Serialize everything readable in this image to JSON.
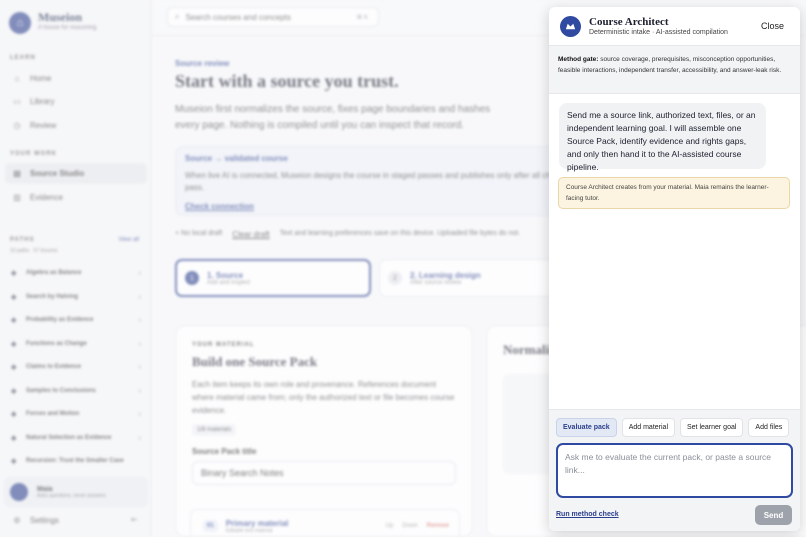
{
  "sidebar": {
    "brand_name": "Museion",
    "brand_tag": "A house for reasoning",
    "learn_header": "LEARN",
    "learn_items": [
      {
        "label": "Home",
        "icon": "home-icon"
      },
      {
        "label": "Library",
        "icon": "library-icon"
      },
      {
        "label": "Review",
        "icon": "review-icon"
      }
    ],
    "work_header": "YOUR WORK",
    "work_items": [
      {
        "label": "Source Studio",
        "icon": "source-icon",
        "active": true
      },
      {
        "label": "Evidence",
        "icon": "chart-icon"
      }
    ],
    "paths_header": "PATHS",
    "paths_view_all": "View all",
    "paths_count": "10 paths · 57 lessons",
    "paths": [
      "Algebra as Balance",
      "Search by Halving",
      "Probability as Evidence",
      "Functions as Change",
      "Claims to Evidence",
      "Samples to Conclusions",
      "Forces and Motion",
      "Natural Selection as Evidence",
      "Recursion: Trust the Smaller Case"
    ],
    "maia_name": "Maia",
    "maia_desc": "Asks questions, never answers",
    "settings": "Settings"
  },
  "main": {
    "search_placeholder": "Search courses and concepts",
    "search_kbd": "⌘ K",
    "eyebrow": "Source review",
    "title": "Start with a source you trust.",
    "lead": "Museion first normalizes the source, fixes page boundaries and hashes every page. Nothing is compiled until you can inspect that record.",
    "callout_title": "Source → validated course",
    "callout_body": "When live AI is connected, Museion designs the course in staged passes and publishes only after all checks pass.",
    "callout_link": "Check connection",
    "no_draft": "No local draft",
    "clear_draft": "Clear draft",
    "device_note": "Text and learning preferences save on this device. Uploaded file bytes do not.",
    "steps": [
      {
        "num": "1",
        "title": "1. Source",
        "sub": "Add and inspect"
      },
      {
        "num": "2",
        "title": "2. Learning design",
        "sub": "After source review"
      }
    ],
    "card_eyebrow": "YOUR MATERIAL",
    "card_title": "Build one Source Pack",
    "card_body": "Each item keeps its own role and provenance. References document where material came from; only the authorized text or file becomes course evidence.",
    "card_chip": "1/8 materials",
    "card_label": "Source Pack title",
    "card_input": "Binary Search Notes",
    "primary_badge": "01",
    "primary_title": "Primary material",
    "primary_sub": "Editable text material",
    "primary_up": "Up",
    "primary_down": "Down",
    "primary_remove": "Remove",
    "card2_title": "Normaliz"
  },
  "panel": {
    "title": "Course Architect",
    "subtitle": "Deterministic intake · AI-assisted compilation",
    "close": "Close",
    "gate_label": "Method gate:",
    "gate_text": "source coverage, prerequisites, misconception opportunities, feasible interactions, independent transfer, accessibility, and answer-leak risk.",
    "message": "Send me a source link, authorized text, files, or an independent learning goal. I will assemble one Source Pack, identify evidence and rights gaps, and only then hand it to the AI-assisted course pipeline.",
    "note": "Course Architect creates from your material. Maia remains the learner-facing tutor.",
    "chips": [
      "Evaluate pack",
      "Add material",
      "Set learner goal",
      "Add files"
    ],
    "input_placeholder": "Ask me to evaluate the current pack, or paste a source link...",
    "run_check": "Run method check",
    "send": "Send"
  }
}
